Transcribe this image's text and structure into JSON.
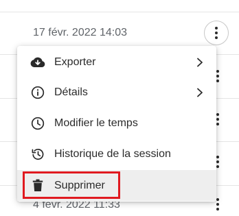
{
  "rows": [
    {
      "date": "17 févr. 2022 14:03"
    },
    {
      "date": "4 févr. 2022 11:33"
    }
  ],
  "menu": {
    "items": [
      {
        "label": "Exporter",
        "icon": "cloud-download-icon",
        "submenu": true
      },
      {
        "label": "Détails",
        "icon": "info-icon",
        "submenu": true
      },
      {
        "label": "Modifier le temps",
        "icon": "clock-icon",
        "submenu": false
      },
      {
        "label": "Historique de la session",
        "icon": "history-icon",
        "submenu": false
      },
      {
        "label": "Supprimer",
        "icon": "trash-icon",
        "submenu": false
      }
    ]
  },
  "colors": {
    "highlight": "#e0191f",
    "hover": "#eeeeee",
    "text": "#2a2a2a"
  }
}
